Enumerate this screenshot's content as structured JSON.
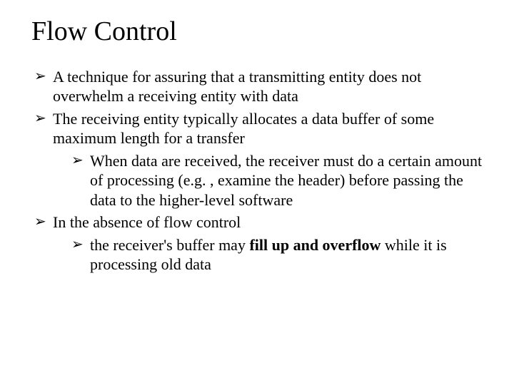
{
  "title": "Flow Control",
  "bullets": {
    "b1": "A technique for assuring that a transmitting entity does not overwhelm a receiving entity with data",
    "b2": "The receiving entity typically allocates a data buffer of some maximum length for a transfer",
    "b2a": "When data are received, the receiver must do a certain amount of processing (e.g. , examine the header) before passing the data to the higher-level software",
    "b3": "In the absence of flow control",
    "b3a_pre": "the receiver's buffer may ",
    "b3a_bold": "fill up and overflow",
    "b3a_post": " while it is processing old data"
  }
}
